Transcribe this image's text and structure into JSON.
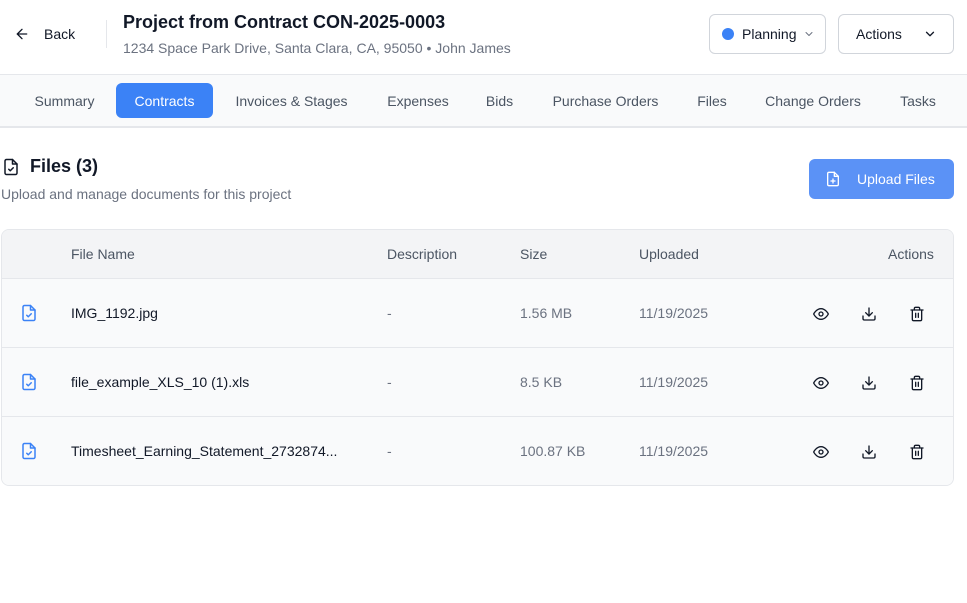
{
  "header": {
    "back_label": "Back",
    "title": "Project from Contract CON-2025-0003",
    "subtitle": "1234 Space Park Drive, Santa Clara, CA, 95050 • John James",
    "status_label": "Planning",
    "status_color": "#3b82f6",
    "actions_label": "Actions"
  },
  "tabs": [
    {
      "label": "Summary",
      "active": false
    },
    {
      "label": "Contracts",
      "active": true
    },
    {
      "label": "Invoices & Stages",
      "active": false
    },
    {
      "label": "Expenses",
      "active": false
    },
    {
      "label": "Bids",
      "active": false
    },
    {
      "label": "Purchase Orders",
      "active": false
    },
    {
      "label": "Files",
      "active": false
    },
    {
      "label": "Change Orders",
      "active": false
    },
    {
      "label": "Tasks",
      "active": false
    }
  ],
  "files": {
    "title": "Files (3)",
    "subtitle": "Upload and manage documents for this project",
    "upload_label": "Upload Files",
    "columns": {
      "name": "File Name",
      "description": "Description",
      "size": "Size",
      "uploaded": "Uploaded",
      "actions": "Actions"
    },
    "rows": [
      {
        "name": "IMG_1192.jpg",
        "description": "-",
        "size": "1.56 MB",
        "uploaded": "11/19/2025"
      },
      {
        "name": "file_example_XLS_10 (1).xls",
        "description": "-",
        "size": "8.5 KB",
        "uploaded": "11/19/2025"
      },
      {
        "name": "Timesheet_Earning_Statement_2732874...",
        "description": "-",
        "size": "100.87 KB",
        "uploaded": "11/19/2025"
      }
    ]
  },
  "colors": {
    "accent": "#3b82f6",
    "upload_button": "#5b92f6"
  },
  "icons": {
    "back": "arrow-left-icon",
    "status_dropdown": "chevron-down-icon",
    "actions_dropdown": "chevron-down-icon",
    "files_header": "file-check-icon",
    "upload": "file-plus-icon",
    "row_file": "file-check-icon",
    "view": "eye-icon",
    "download": "download-icon",
    "delete": "trash-icon"
  }
}
